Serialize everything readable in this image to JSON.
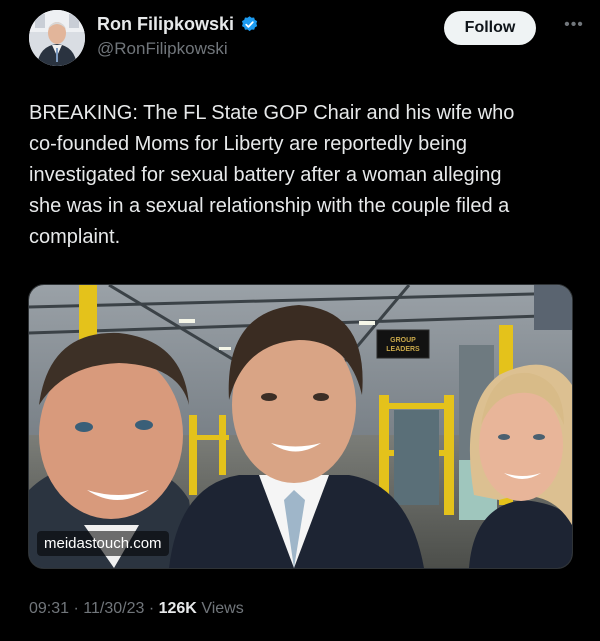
{
  "author": {
    "display_name": "Ron Filipkowski",
    "handle": "@RonFilipkowski",
    "verified": true
  },
  "follow_label": "Follow",
  "more_icon": "more-icon",
  "tweet": {
    "text": "BREAKING: The FL State GOP Chair and his wife who\nco-founded Moms for Liberty are reportedly being\ninvestigated for sexual battery after a woman alleging\nshe was in a sexual relationship with the couple filed a\ncomplaint."
  },
  "media": {
    "watermark": "meidastouch.com",
    "sign_text_line1": "GROUP",
    "sign_text_line2": "LEADERS"
  },
  "meta": {
    "time": "09:31",
    "separator": "·",
    "date": "11/30/23",
    "views_count": "126K",
    "views_label": "Views"
  },
  "colors": {
    "background": "#000000",
    "text_primary": "#e7e9ea",
    "text_secondary": "#71767b",
    "verified_blue": "#1d9bf0",
    "follow_bg": "#eff3f4"
  }
}
